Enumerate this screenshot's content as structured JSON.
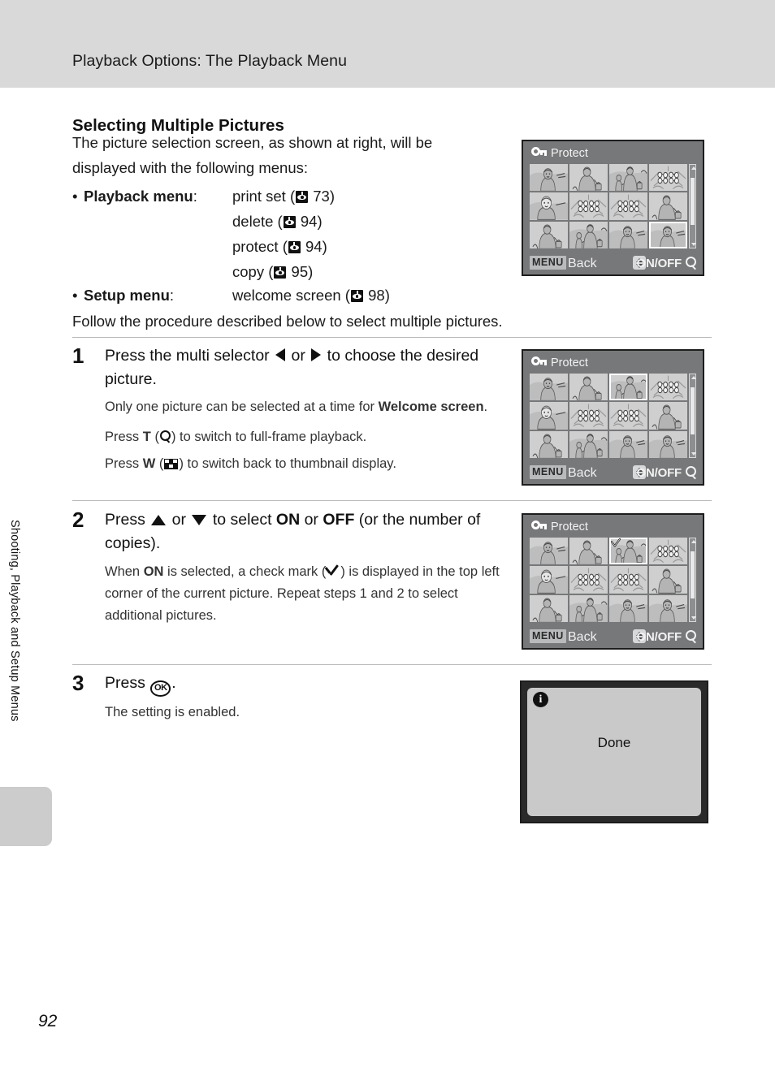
{
  "header": {
    "running_title": "Playback Options: The Playback Menu"
  },
  "side": {
    "vertical_label": "Shooting, Playback and Setup Menus",
    "page_number": "92"
  },
  "section": {
    "heading": "Selecting Multiple Pictures",
    "intro_line1": "The picture selection screen, as shown at right, will be",
    "intro_line2": "displayed with the following menus:",
    "bullets": [
      {
        "label": "Playback menu",
        "separator": ":",
        "entries": [
          {
            "name": "print set",
            "ref_icon": "page-ref-icon",
            "page": "73"
          },
          {
            "name": "delete",
            "ref_icon": "page-ref-icon",
            "page": "94"
          },
          {
            "name": "protect",
            "ref_icon": "page-ref-icon",
            "page": "94"
          },
          {
            "name": "copy",
            "ref_icon": "page-ref-icon",
            "page": "95"
          }
        ]
      },
      {
        "label": "Setup menu",
        "separator": ":",
        "entries": [
          {
            "name": "welcome screen",
            "ref_icon": "page-ref-icon",
            "page": "98"
          }
        ]
      }
    ],
    "follow_text": "Follow the procedure described below to select multiple pictures."
  },
  "steps": [
    {
      "number": "1",
      "title_a": "Press the multi selector ",
      "title_icon_left": "left-triangle-icon",
      "title_b": " or ",
      "title_icon_right": "right-triangle-icon",
      "title_c": " to choose the desired picture.",
      "body": [
        {
          "a": "Only one picture can be selected at a time for ",
          "bold": "Welcome screen",
          "b": "."
        },
        {
          "a": "Press ",
          "bold": "T",
          "b": " (",
          "icon": "magnifier-icon",
          "c": ") to switch to full-frame playback."
        },
        {
          "a": "Press ",
          "bold": "W",
          "b": " (",
          "icon": "thumbnail-grid-icon",
          "c": ") to switch back to thumbnail display."
        }
      ]
    },
    {
      "number": "2",
      "title_a": "Press ",
      "title_icon_up": "up-triangle-icon",
      "title_b": " or ",
      "title_icon_down": "down-triangle-icon",
      "title_c": " to select ",
      "title_on": "ON",
      "title_d": " or ",
      "title_off": "OFF",
      "title_e": " (or the number of copies).",
      "body_a": "When ",
      "body_on": "ON",
      "body_b": " is selected, a check mark (",
      "body_icon": "check-mark-icon",
      "body_c": ") is displayed in the top left corner of the current picture. Repeat steps 1 and 2 to select additional pictures."
    },
    {
      "number": "3",
      "title_a": "Press ",
      "title_icon_ok": "ok-button-icon",
      "title_ok_label": "OK",
      "title_b": ".",
      "body": "The setting is enabled."
    }
  ],
  "lcd_screens": [
    {
      "id": "protect-screen-intro",
      "title": "Protect",
      "title_icon": "key-icon",
      "selected_cell": 11,
      "check_on_selected": false,
      "footer": {
        "menu_label": "MENU",
        "back_label": "Back",
        "updown_icon": "up-down-arrows-icon",
        "onoff_label": "ON/OFF",
        "magnifier_icon": "magnifier-icon"
      }
    },
    {
      "id": "protect-screen-step1",
      "title": "Protect",
      "title_icon": "key-icon",
      "selected_cell": 2,
      "check_on_selected": false,
      "footer": {
        "menu_label": "MENU",
        "back_label": "Back",
        "updown_icon": "up-down-arrows-icon",
        "onoff_label": "ON/OFF",
        "magnifier_icon": "magnifier-icon"
      }
    },
    {
      "id": "protect-screen-step2",
      "title": "Protect",
      "title_icon": "key-icon",
      "selected_cell": 2,
      "check_on_selected": true,
      "footer": {
        "menu_label": "MENU",
        "back_label": "Back",
        "updown_icon": "up-down-arrows-icon",
        "onoff_label": "ON/OFF",
        "magnifier_icon": "magnifier-icon"
      }
    }
  ],
  "done_screen": {
    "id": "done-screen",
    "info_icon": "info-icon",
    "info_glyph": "i",
    "message": "Done"
  },
  "colors": {
    "header_bar": "#d9d9d9",
    "lcd_body": "#77787a",
    "lcd_border": "#1d1d1d",
    "thumb_bg": "#c9c9c9",
    "side_tab": "#cccccc"
  }
}
